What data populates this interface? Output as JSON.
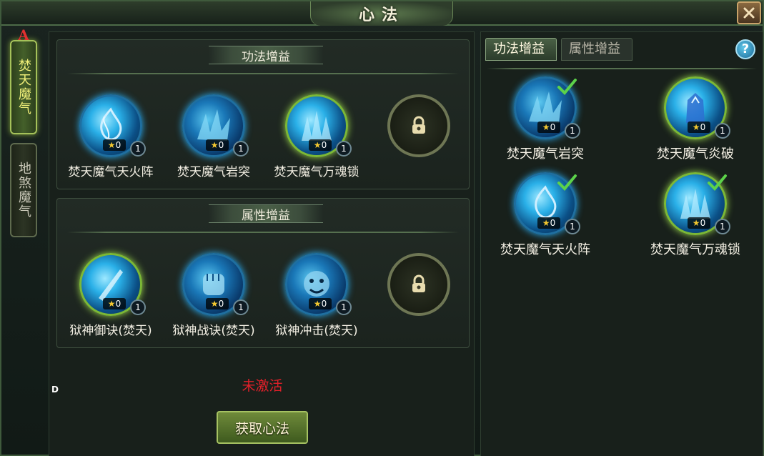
{
  "window": {
    "title": "心法",
    "close_icon": "close-x-icon"
  },
  "side_tabs": [
    {
      "label": "焚天魔气",
      "active": true
    },
    {
      "label": "地煞魔气",
      "active": false
    }
  ],
  "side_badge": "A",
  "left": {
    "sections": [
      {
        "title": "功法增益",
        "skills": [
          {
            "name": "焚天魔气天火阵",
            "stars": "0",
            "level": "1",
            "icon": "flame-array-icon",
            "ring": "blue"
          },
          {
            "name": "焚天魔气岩突",
            "stars": "0",
            "level": "1",
            "icon": "rock-spike-icon",
            "ring": "blue"
          },
          {
            "name": "焚天魔气万魂锁",
            "stars": "0",
            "level": "1",
            "icon": "soul-lock-icon",
            "ring": "green"
          }
        ],
        "locked_icon": "lock-icon"
      },
      {
        "title": "属性增益",
        "skills": [
          {
            "name": "狱神御诀(焚天)",
            "stars": "0",
            "level": "1",
            "icon": "defense-art-icon",
            "ring": "green"
          },
          {
            "name": "狱神战诀(焚天)",
            "stars": "0",
            "level": "1",
            "icon": "fist-icon",
            "ring": "blue"
          },
          {
            "name": "狱神冲击(焚天)",
            "stars": "0",
            "level": "1",
            "icon": "demon-face-icon",
            "ring": "blue"
          }
        ],
        "locked_icon": "lock-icon"
      }
    ],
    "status": "未激活",
    "get_button": "获取心法",
    "marker": "D"
  },
  "right": {
    "tabs": [
      {
        "label": "功法增益",
        "active": true
      },
      {
        "label": "属性增益",
        "active": false
      }
    ],
    "help": "?",
    "skills": [
      {
        "name": "焚天魔气岩突",
        "stars": "0",
        "level": "1",
        "checked": true,
        "ring": "blue"
      },
      {
        "name": "焚天魔气炎破",
        "stars": "0",
        "level": "1",
        "checked": false,
        "ring": "green"
      },
      {
        "name": "焚天魔气天火阵",
        "stars": "0",
        "level": "1",
        "checked": true,
        "ring": "blue"
      },
      {
        "name": "焚天魔气万魂锁",
        "stars": "0",
        "level": "1",
        "checked": true,
        "ring": "green"
      }
    ]
  },
  "colors": {
    "accent_green": "#a5c25a",
    "status_red": "#e0202a",
    "orb_blue": "#2ab0e8",
    "star": "#f4c830"
  }
}
